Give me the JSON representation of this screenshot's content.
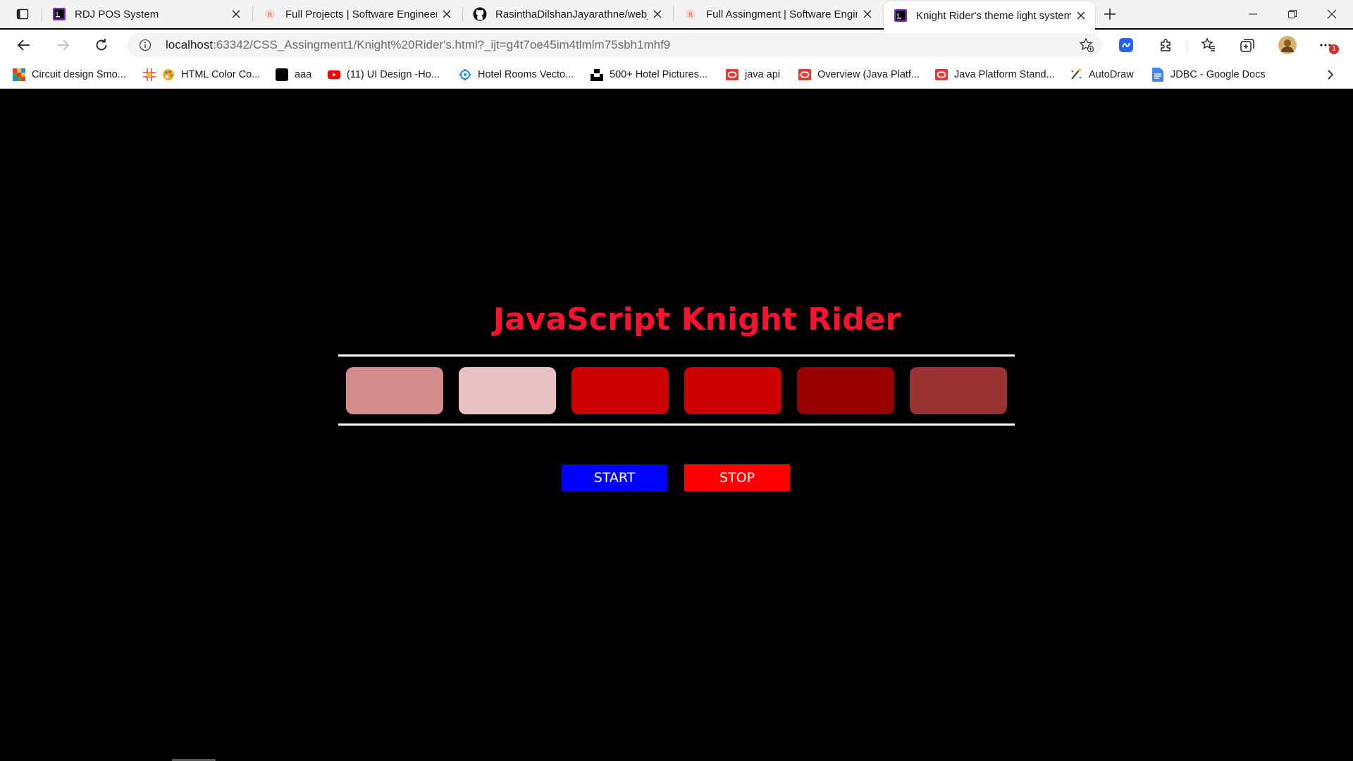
{
  "browser": {
    "tabs": [
      {
        "title": "RDJ POS System",
        "icon": "intellij-icon",
        "active": false
      },
      {
        "title": "Full Projects | Software Engineer",
        "icon": "ijse-icon",
        "active": false
      },
      {
        "title": "RasinthaDilshanJayarathne/web_",
        "icon": "github-icon",
        "active": false
      },
      {
        "title": "Full Assingment | Software Engin",
        "icon": "ijse-icon",
        "active": false
      },
      {
        "title": "Knight Rider's theme light system",
        "icon": "intellij-icon",
        "active": true
      }
    ],
    "url_host": "localhost",
    "url_rest": ":63342/CSS_Assingment1/Knight%20Rider's.html?_ijt=g4t7oe45im4tlmlm75sbh1mhf9",
    "profile_badge": "1",
    "bookmarks": [
      {
        "label": "Circuit design Smo...",
        "icon": "tinkercad-icon"
      },
      {
        "label": "HTML Color Co...",
        "icon": "palette-icon"
      },
      {
        "label": "aaa",
        "icon": "black-square-icon"
      },
      {
        "label": "(11) UI Design -Ho...",
        "icon": "youtube-icon"
      },
      {
        "label": "Hotel Rooms Vecto...",
        "icon": "freepik-icon"
      },
      {
        "label": "500+ Hotel Pictures...",
        "icon": "unsplash-icon"
      },
      {
        "label": "java api",
        "icon": "oracle-icon"
      },
      {
        "label": "Overview (Java Platf...",
        "icon": "oracle-icon"
      },
      {
        "label": "Java Platform Stand...",
        "icon": "oracle-icon"
      },
      {
        "label": "AutoDraw",
        "icon": "autodraw-icon"
      },
      {
        "label": "JDBC - Google Docs",
        "icon": "google-docs-icon"
      }
    ]
  },
  "page": {
    "title": "JavaScript Knight Rider",
    "lights": [
      {
        "color": "#d48c8c"
      },
      {
        "color": "#e8c2c2"
      },
      {
        "color": "#cc0000"
      },
      {
        "color": "#cc0000"
      },
      {
        "color": "#990000"
      },
      {
        "color": "#993333"
      }
    ],
    "start_label": "START",
    "stop_label": "STOP",
    "colors": {
      "title": "#f5132f",
      "start_bg": "#0000ff",
      "stop_bg": "#ff0000",
      "background": "#000000"
    }
  }
}
